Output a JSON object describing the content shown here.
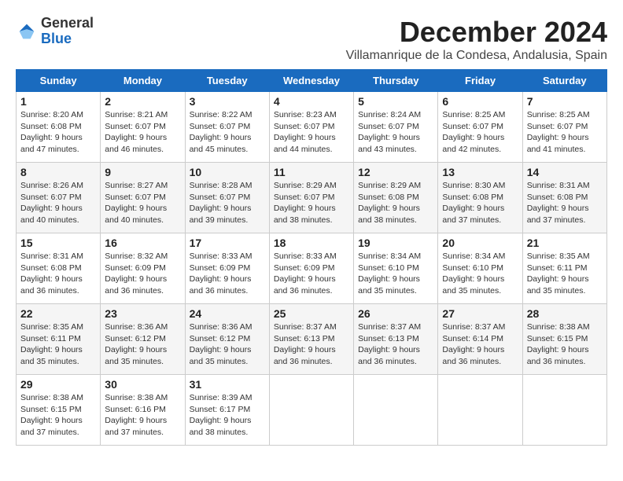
{
  "logo": {
    "general": "General",
    "blue": "Blue"
  },
  "title": "December 2024",
  "location": "Villamanrique de la Condesa, Andalusia, Spain",
  "headers": [
    "Sunday",
    "Monday",
    "Tuesday",
    "Wednesday",
    "Thursday",
    "Friday",
    "Saturday"
  ],
  "weeks": [
    [
      {
        "day": "1",
        "sunrise": "Sunrise: 8:20 AM",
        "sunset": "Sunset: 6:08 PM",
        "daylight": "Daylight: 9 hours and 47 minutes."
      },
      {
        "day": "2",
        "sunrise": "Sunrise: 8:21 AM",
        "sunset": "Sunset: 6:07 PM",
        "daylight": "Daylight: 9 hours and 46 minutes."
      },
      {
        "day": "3",
        "sunrise": "Sunrise: 8:22 AM",
        "sunset": "Sunset: 6:07 PM",
        "daylight": "Daylight: 9 hours and 45 minutes."
      },
      {
        "day": "4",
        "sunrise": "Sunrise: 8:23 AM",
        "sunset": "Sunset: 6:07 PM",
        "daylight": "Daylight: 9 hours and 44 minutes."
      },
      {
        "day": "5",
        "sunrise": "Sunrise: 8:24 AM",
        "sunset": "Sunset: 6:07 PM",
        "daylight": "Daylight: 9 hours and 43 minutes."
      },
      {
        "day": "6",
        "sunrise": "Sunrise: 8:25 AM",
        "sunset": "Sunset: 6:07 PM",
        "daylight": "Daylight: 9 hours and 42 minutes."
      },
      {
        "day": "7",
        "sunrise": "Sunrise: 8:25 AM",
        "sunset": "Sunset: 6:07 PM",
        "daylight": "Daylight: 9 hours and 41 minutes."
      }
    ],
    [
      {
        "day": "8",
        "sunrise": "Sunrise: 8:26 AM",
        "sunset": "Sunset: 6:07 PM",
        "daylight": "Daylight: 9 hours and 40 minutes."
      },
      {
        "day": "9",
        "sunrise": "Sunrise: 8:27 AM",
        "sunset": "Sunset: 6:07 PM",
        "daylight": "Daylight: 9 hours and 40 minutes."
      },
      {
        "day": "10",
        "sunrise": "Sunrise: 8:28 AM",
        "sunset": "Sunset: 6:07 PM",
        "daylight": "Daylight: 9 hours and 39 minutes."
      },
      {
        "day": "11",
        "sunrise": "Sunrise: 8:29 AM",
        "sunset": "Sunset: 6:07 PM",
        "daylight": "Daylight: 9 hours and 38 minutes."
      },
      {
        "day": "12",
        "sunrise": "Sunrise: 8:29 AM",
        "sunset": "Sunset: 6:08 PM",
        "daylight": "Daylight: 9 hours and 38 minutes."
      },
      {
        "day": "13",
        "sunrise": "Sunrise: 8:30 AM",
        "sunset": "Sunset: 6:08 PM",
        "daylight": "Daylight: 9 hours and 37 minutes."
      },
      {
        "day": "14",
        "sunrise": "Sunrise: 8:31 AM",
        "sunset": "Sunset: 6:08 PM",
        "daylight": "Daylight: 9 hours and 37 minutes."
      }
    ],
    [
      {
        "day": "15",
        "sunrise": "Sunrise: 8:31 AM",
        "sunset": "Sunset: 6:08 PM",
        "daylight": "Daylight: 9 hours and 36 minutes."
      },
      {
        "day": "16",
        "sunrise": "Sunrise: 8:32 AM",
        "sunset": "Sunset: 6:09 PM",
        "daylight": "Daylight: 9 hours and 36 minutes."
      },
      {
        "day": "17",
        "sunrise": "Sunrise: 8:33 AM",
        "sunset": "Sunset: 6:09 PM",
        "daylight": "Daylight: 9 hours and 36 minutes."
      },
      {
        "day": "18",
        "sunrise": "Sunrise: 8:33 AM",
        "sunset": "Sunset: 6:09 PM",
        "daylight": "Daylight: 9 hours and 36 minutes."
      },
      {
        "day": "19",
        "sunrise": "Sunrise: 8:34 AM",
        "sunset": "Sunset: 6:10 PM",
        "daylight": "Daylight: 9 hours and 35 minutes."
      },
      {
        "day": "20",
        "sunrise": "Sunrise: 8:34 AM",
        "sunset": "Sunset: 6:10 PM",
        "daylight": "Daylight: 9 hours and 35 minutes."
      },
      {
        "day": "21",
        "sunrise": "Sunrise: 8:35 AM",
        "sunset": "Sunset: 6:11 PM",
        "daylight": "Daylight: 9 hours and 35 minutes."
      }
    ],
    [
      {
        "day": "22",
        "sunrise": "Sunrise: 8:35 AM",
        "sunset": "Sunset: 6:11 PM",
        "daylight": "Daylight: 9 hours and 35 minutes."
      },
      {
        "day": "23",
        "sunrise": "Sunrise: 8:36 AM",
        "sunset": "Sunset: 6:12 PM",
        "daylight": "Daylight: 9 hours and 35 minutes."
      },
      {
        "day": "24",
        "sunrise": "Sunrise: 8:36 AM",
        "sunset": "Sunset: 6:12 PM",
        "daylight": "Daylight: 9 hours and 35 minutes."
      },
      {
        "day": "25",
        "sunrise": "Sunrise: 8:37 AM",
        "sunset": "Sunset: 6:13 PM",
        "daylight": "Daylight: 9 hours and 36 minutes."
      },
      {
        "day": "26",
        "sunrise": "Sunrise: 8:37 AM",
        "sunset": "Sunset: 6:13 PM",
        "daylight": "Daylight: 9 hours and 36 minutes."
      },
      {
        "day": "27",
        "sunrise": "Sunrise: 8:37 AM",
        "sunset": "Sunset: 6:14 PM",
        "daylight": "Daylight: 9 hours and 36 minutes."
      },
      {
        "day": "28",
        "sunrise": "Sunrise: 8:38 AM",
        "sunset": "Sunset: 6:15 PM",
        "daylight": "Daylight: 9 hours and 36 minutes."
      }
    ],
    [
      {
        "day": "29",
        "sunrise": "Sunrise: 8:38 AM",
        "sunset": "Sunset: 6:15 PM",
        "daylight": "Daylight: 9 hours and 37 minutes."
      },
      {
        "day": "30",
        "sunrise": "Sunrise: 8:38 AM",
        "sunset": "Sunset: 6:16 PM",
        "daylight": "Daylight: 9 hours and 37 minutes."
      },
      {
        "day": "31",
        "sunrise": "Sunrise: 8:39 AM",
        "sunset": "Sunset: 6:17 PM",
        "daylight": "Daylight: 9 hours and 38 minutes."
      },
      null,
      null,
      null,
      null
    ]
  ]
}
